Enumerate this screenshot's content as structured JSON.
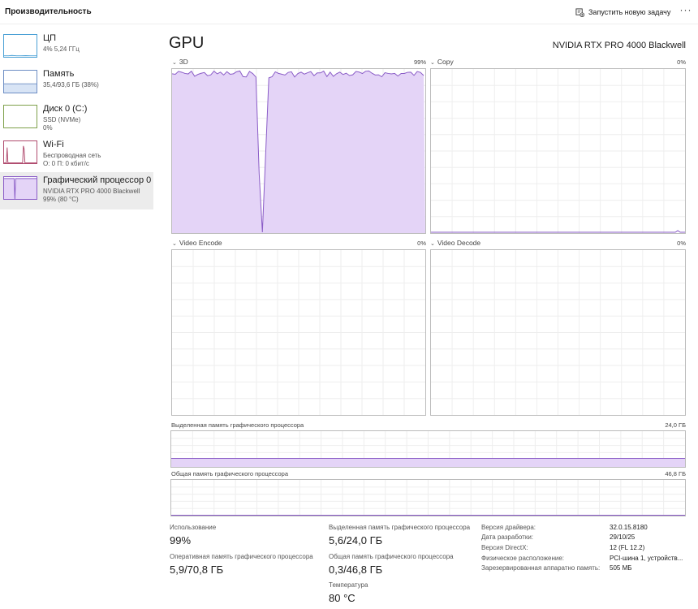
{
  "header": {
    "title": "Производительность",
    "new_task_label": "Запустить новую задачу",
    "more_label": "···"
  },
  "sidebar": {
    "items": [
      {
        "name": "ЦП",
        "sub1": "4%  5,24 ГГц",
        "sub2": ""
      },
      {
        "name": "Память",
        "sub1": "35,4/93,6 ГБ (38%)",
        "sub2": ""
      },
      {
        "name": "Диск 0 (C:)",
        "sub1": "SSD (NVMe)",
        "sub2": "0%"
      },
      {
        "name": "Wi-Fi",
        "sub1": "Беспроводная сеть",
        "sub2": "О: 0 П: 0 кбит/с"
      },
      {
        "name": "Графический процессор 0",
        "sub1": "NVIDIA RTX PRO 4000 Blackwell",
        "sub2": "99%  (80 °C)"
      }
    ],
    "selected_index": 4
  },
  "main": {
    "title": "GPU",
    "model": "NVIDIA RTX PRO 4000 Blackwell",
    "panels": [
      {
        "label": "3D",
        "pct": "99%"
      },
      {
        "label": "Copy",
        "pct": "0%"
      },
      {
        "label": "Video Encode",
        "pct": "0%"
      },
      {
        "label": "Video Decode",
        "pct": "0%"
      }
    ],
    "dedicated_memory": {
      "label": "Выделенная память графического процессора",
      "capacity": "24,0 ГБ"
    },
    "shared_memory": {
      "label": "Общая память графического процессора",
      "capacity": "46,8 ГБ"
    }
  },
  "stats": {
    "usage_label": "Использование",
    "usage_value": "99%",
    "ram_label": "Оперативная память графического процессора",
    "ram_value": "5,9/70,8 ГБ",
    "dedicated_label": "Выделенная память графического процессора",
    "dedicated_value": "5,6/24,0 ГБ",
    "shared_label": "Общая память графического процессора",
    "shared_value": "0,3/46,8 ГБ",
    "temp_label": "Температура",
    "temp_value": "80 °C"
  },
  "info": [
    {
      "key": "Версия драйвера:",
      "value": "32.0.15.8180"
    },
    {
      "key": "Дата разработки:",
      "value": "29/10/25"
    },
    {
      "key": "Версия DirectX:",
      "value": "12 (FL 12.2)"
    },
    {
      "key": "Физическое расположение:",
      "value": "PCI-шина 1, устройств..."
    },
    {
      "key": "Зарезервированная аппаратно память:",
      "value": "505 МБ"
    }
  ],
  "colors": {
    "gpu_line": "#8a5cc7",
    "gpu_fill": "#e4d4f7",
    "grid": "#eeeeee",
    "cpu_line": "#4aa0d5",
    "mem_line": "#6d8ec4",
    "disk_line": "#7ea04a",
    "wifi_line": "#b04b6e"
  },
  "icons": {
    "new_task": "new-task-icon",
    "more": "more-icon"
  }
}
